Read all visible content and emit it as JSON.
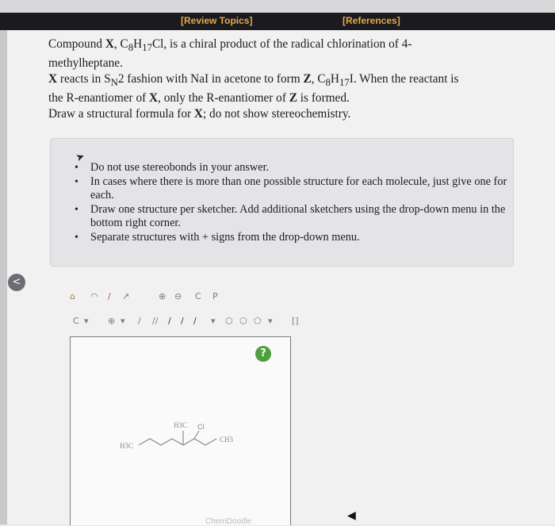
{
  "header": {
    "tabs": [
      "[Review Topics]",
      "[References]"
    ]
  },
  "question": {
    "line1_prefix": "Compound ",
    "compound": "X",
    "line1_formula_a": ", C",
    "sub8": "8",
    "formula_h": "H",
    "sub17": "17",
    "line1_formula_b": "Cl, is a chiral product of the radical chlorination of 4-",
    "line2": "methylheptane.",
    "line3_a": "X",
    "line3_b": " reacts in S",
    "sub_n": "N",
    "line3_c": "2 fashion with NaI in acetone to form ",
    "line3_z": "Z",
    "line3_d": ", C",
    "line3_e": "I. When the reactant is",
    "line4_a": "the R-enantiomer of ",
    "line4_b": ", only the R-enantiomer of ",
    "line4_c": " is formed.",
    "line5_a": "Draw a structural formula for ",
    "line5_b": "; do not show stereochemistry."
  },
  "instructions": [
    "Do not use stereobonds in your answer.",
    "In cases where there is more than one possible structure for each molecule, just give one for each.",
    "Draw one structure per sketcher. Add additional sketchers using the drop-down menu in the bottom right corner.",
    "Separate structures with + signs from the drop-down menu."
  ],
  "sketcher": {
    "help_label": "?",
    "molecule_labels": {
      "left": "H3C",
      "top": "H3C",
      "cl": "Cl",
      "right": "CH3"
    },
    "footer": "ChemDoodle"
  },
  "colors": {
    "tab": "#e6a94a",
    "help": "#4e9f3f",
    "band": "#1a1a1f"
  }
}
